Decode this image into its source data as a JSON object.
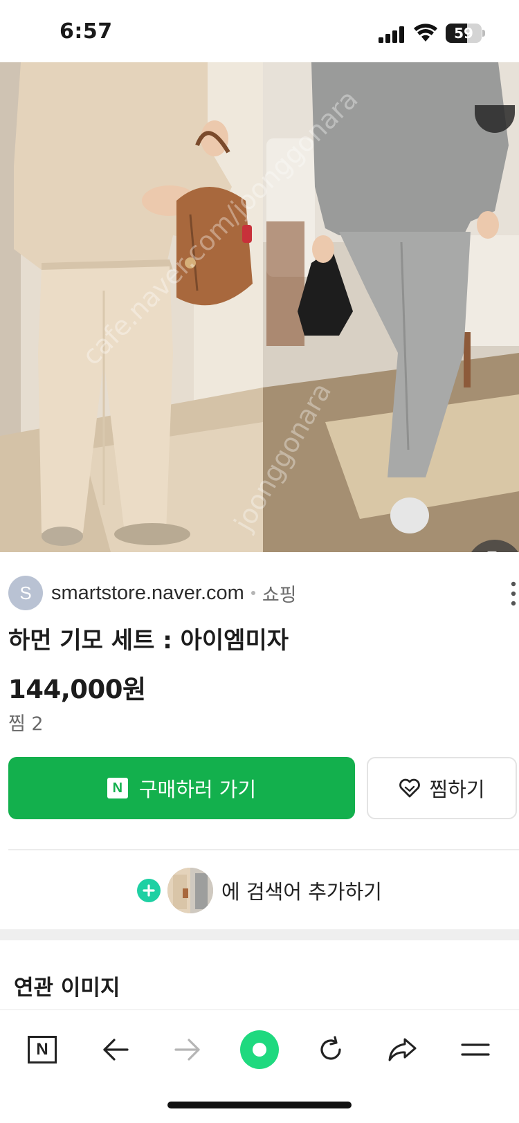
{
  "status_bar": {
    "time": "6:57",
    "battery": "59",
    "battery_level": 0.59
  },
  "result": {
    "source_initial": "S",
    "source_domain": "smartstore.naver.com",
    "source_category": "쇼핑",
    "title": "하먼 기모 세트 : 아이엠미자",
    "price": "144,000원",
    "wish_count": "찜 2"
  },
  "actions": {
    "buy_badge": "N",
    "buy_label": "구매하러 가기",
    "wish_label": "찜하기"
  },
  "add_search": {
    "label": "에 검색어 추가하기"
  },
  "related": {
    "title": "연관 이미지"
  },
  "bottom_nav": {
    "home_badge": "N"
  },
  "colors": {
    "buy_green": "#13b04d",
    "plus_mint": "#1ed0a3",
    "nav_green": "#1fd97f"
  },
  "icons": [
    "signal-icon",
    "wifi-icon",
    "battery-icon",
    "lens-search-icon",
    "more-vertical-icon",
    "heart-icon",
    "plus-icon",
    "back-arrow-icon",
    "forward-arrow-icon",
    "reload-icon",
    "share-icon",
    "menu-icon"
  ]
}
